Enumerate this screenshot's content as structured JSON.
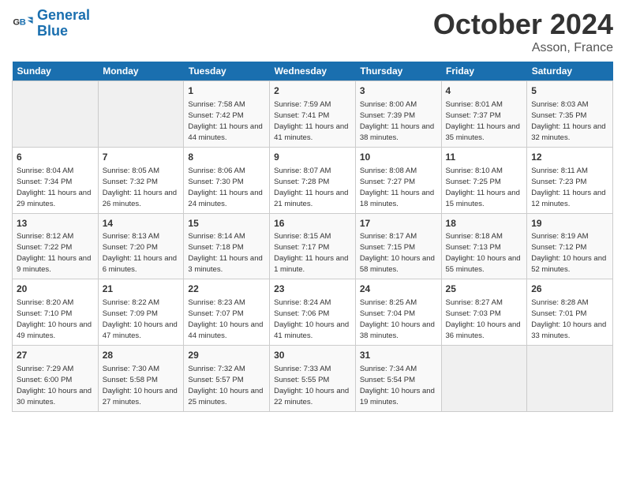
{
  "header": {
    "logo_line1": "General",
    "logo_line2": "Blue",
    "month": "October 2024",
    "location": "Asson, France"
  },
  "weekdays": [
    "Sunday",
    "Monday",
    "Tuesday",
    "Wednesday",
    "Thursday",
    "Friday",
    "Saturday"
  ],
  "weeks": [
    [
      {
        "num": "",
        "sunrise": "",
        "sunset": "",
        "daylight": "",
        "empty": true
      },
      {
        "num": "",
        "sunrise": "",
        "sunset": "",
        "daylight": "",
        "empty": true
      },
      {
        "num": "1",
        "sunrise": "Sunrise: 7:58 AM",
        "sunset": "Sunset: 7:42 PM",
        "daylight": "Daylight: 11 hours and 44 minutes."
      },
      {
        "num": "2",
        "sunrise": "Sunrise: 7:59 AM",
        "sunset": "Sunset: 7:41 PM",
        "daylight": "Daylight: 11 hours and 41 minutes."
      },
      {
        "num": "3",
        "sunrise": "Sunrise: 8:00 AM",
        "sunset": "Sunset: 7:39 PM",
        "daylight": "Daylight: 11 hours and 38 minutes."
      },
      {
        "num": "4",
        "sunrise": "Sunrise: 8:01 AM",
        "sunset": "Sunset: 7:37 PM",
        "daylight": "Daylight: 11 hours and 35 minutes."
      },
      {
        "num": "5",
        "sunrise": "Sunrise: 8:03 AM",
        "sunset": "Sunset: 7:35 PM",
        "daylight": "Daylight: 11 hours and 32 minutes."
      }
    ],
    [
      {
        "num": "6",
        "sunrise": "Sunrise: 8:04 AM",
        "sunset": "Sunset: 7:34 PM",
        "daylight": "Daylight: 11 hours and 29 minutes."
      },
      {
        "num": "7",
        "sunrise": "Sunrise: 8:05 AM",
        "sunset": "Sunset: 7:32 PM",
        "daylight": "Daylight: 11 hours and 26 minutes."
      },
      {
        "num": "8",
        "sunrise": "Sunrise: 8:06 AM",
        "sunset": "Sunset: 7:30 PM",
        "daylight": "Daylight: 11 hours and 24 minutes."
      },
      {
        "num": "9",
        "sunrise": "Sunrise: 8:07 AM",
        "sunset": "Sunset: 7:28 PM",
        "daylight": "Daylight: 11 hours and 21 minutes."
      },
      {
        "num": "10",
        "sunrise": "Sunrise: 8:08 AM",
        "sunset": "Sunset: 7:27 PM",
        "daylight": "Daylight: 11 hours and 18 minutes."
      },
      {
        "num": "11",
        "sunrise": "Sunrise: 8:10 AM",
        "sunset": "Sunset: 7:25 PM",
        "daylight": "Daylight: 11 hours and 15 minutes."
      },
      {
        "num": "12",
        "sunrise": "Sunrise: 8:11 AM",
        "sunset": "Sunset: 7:23 PM",
        "daylight": "Daylight: 11 hours and 12 minutes."
      }
    ],
    [
      {
        "num": "13",
        "sunrise": "Sunrise: 8:12 AM",
        "sunset": "Sunset: 7:22 PM",
        "daylight": "Daylight: 11 hours and 9 minutes."
      },
      {
        "num": "14",
        "sunrise": "Sunrise: 8:13 AM",
        "sunset": "Sunset: 7:20 PM",
        "daylight": "Daylight: 11 hours and 6 minutes."
      },
      {
        "num": "15",
        "sunrise": "Sunrise: 8:14 AM",
        "sunset": "Sunset: 7:18 PM",
        "daylight": "Daylight: 11 hours and 3 minutes."
      },
      {
        "num": "16",
        "sunrise": "Sunrise: 8:15 AM",
        "sunset": "Sunset: 7:17 PM",
        "daylight": "Daylight: 11 hours and 1 minute."
      },
      {
        "num": "17",
        "sunrise": "Sunrise: 8:17 AM",
        "sunset": "Sunset: 7:15 PM",
        "daylight": "Daylight: 10 hours and 58 minutes."
      },
      {
        "num": "18",
        "sunrise": "Sunrise: 8:18 AM",
        "sunset": "Sunset: 7:13 PM",
        "daylight": "Daylight: 10 hours and 55 minutes."
      },
      {
        "num": "19",
        "sunrise": "Sunrise: 8:19 AM",
        "sunset": "Sunset: 7:12 PM",
        "daylight": "Daylight: 10 hours and 52 minutes."
      }
    ],
    [
      {
        "num": "20",
        "sunrise": "Sunrise: 8:20 AM",
        "sunset": "Sunset: 7:10 PM",
        "daylight": "Daylight: 10 hours and 49 minutes."
      },
      {
        "num": "21",
        "sunrise": "Sunrise: 8:22 AM",
        "sunset": "Sunset: 7:09 PM",
        "daylight": "Daylight: 10 hours and 47 minutes."
      },
      {
        "num": "22",
        "sunrise": "Sunrise: 8:23 AM",
        "sunset": "Sunset: 7:07 PM",
        "daylight": "Daylight: 10 hours and 44 minutes."
      },
      {
        "num": "23",
        "sunrise": "Sunrise: 8:24 AM",
        "sunset": "Sunset: 7:06 PM",
        "daylight": "Daylight: 10 hours and 41 minutes."
      },
      {
        "num": "24",
        "sunrise": "Sunrise: 8:25 AM",
        "sunset": "Sunset: 7:04 PM",
        "daylight": "Daylight: 10 hours and 38 minutes."
      },
      {
        "num": "25",
        "sunrise": "Sunrise: 8:27 AM",
        "sunset": "Sunset: 7:03 PM",
        "daylight": "Daylight: 10 hours and 36 minutes."
      },
      {
        "num": "26",
        "sunrise": "Sunrise: 8:28 AM",
        "sunset": "Sunset: 7:01 PM",
        "daylight": "Daylight: 10 hours and 33 minutes."
      }
    ],
    [
      {
        "num": "27",
        "sunrise": "Sunrise: 7:29 AM",
        "sunset": "Sunset: 6:00 PM",
        "daylight": "Daylight: 10 hours and 30 minutes."
      },
      {
        "num": "28",
        "sunrise": "Sunrise: 7:30 AM",
        "sunset": "Sunset: 5:58 PM",
        "daylight": "Daylight: 10 hours and 27 minutes."
      },
      {
        "num": "29",
        "sunrise": "Sunrise: 7:32 AM",
        "sunset": "Sunset: 5:57 PM",
        "daylight": "Daylight: 10 hours and 25 minutes."
      },
      {
        "num": "30",
        "sunrise": "Sunrise: 7:33 AM",
        "sunset": "Sunset: 5:55 PM",
        "daylight": "Daylight: 10 hours and 22 minutes."
      },
      {
        "num": "31",
        "sunrise": "Sunrise: 7:34 AM",
        "sunset": "Sunset: 5:54 PM",
        "daylight": "Daylight: 10 hours and 19 minutes."
      },
      {
        "num": "",
        "sunrise": "",
        "sunset": "",
        "daylight": "",
        "empty": true
      },
      {
        "num": "",
        "sunrise": "",
        "sunset": "",
        "daylight": "",
        "empty": true
      }
    ]
  ]
}
